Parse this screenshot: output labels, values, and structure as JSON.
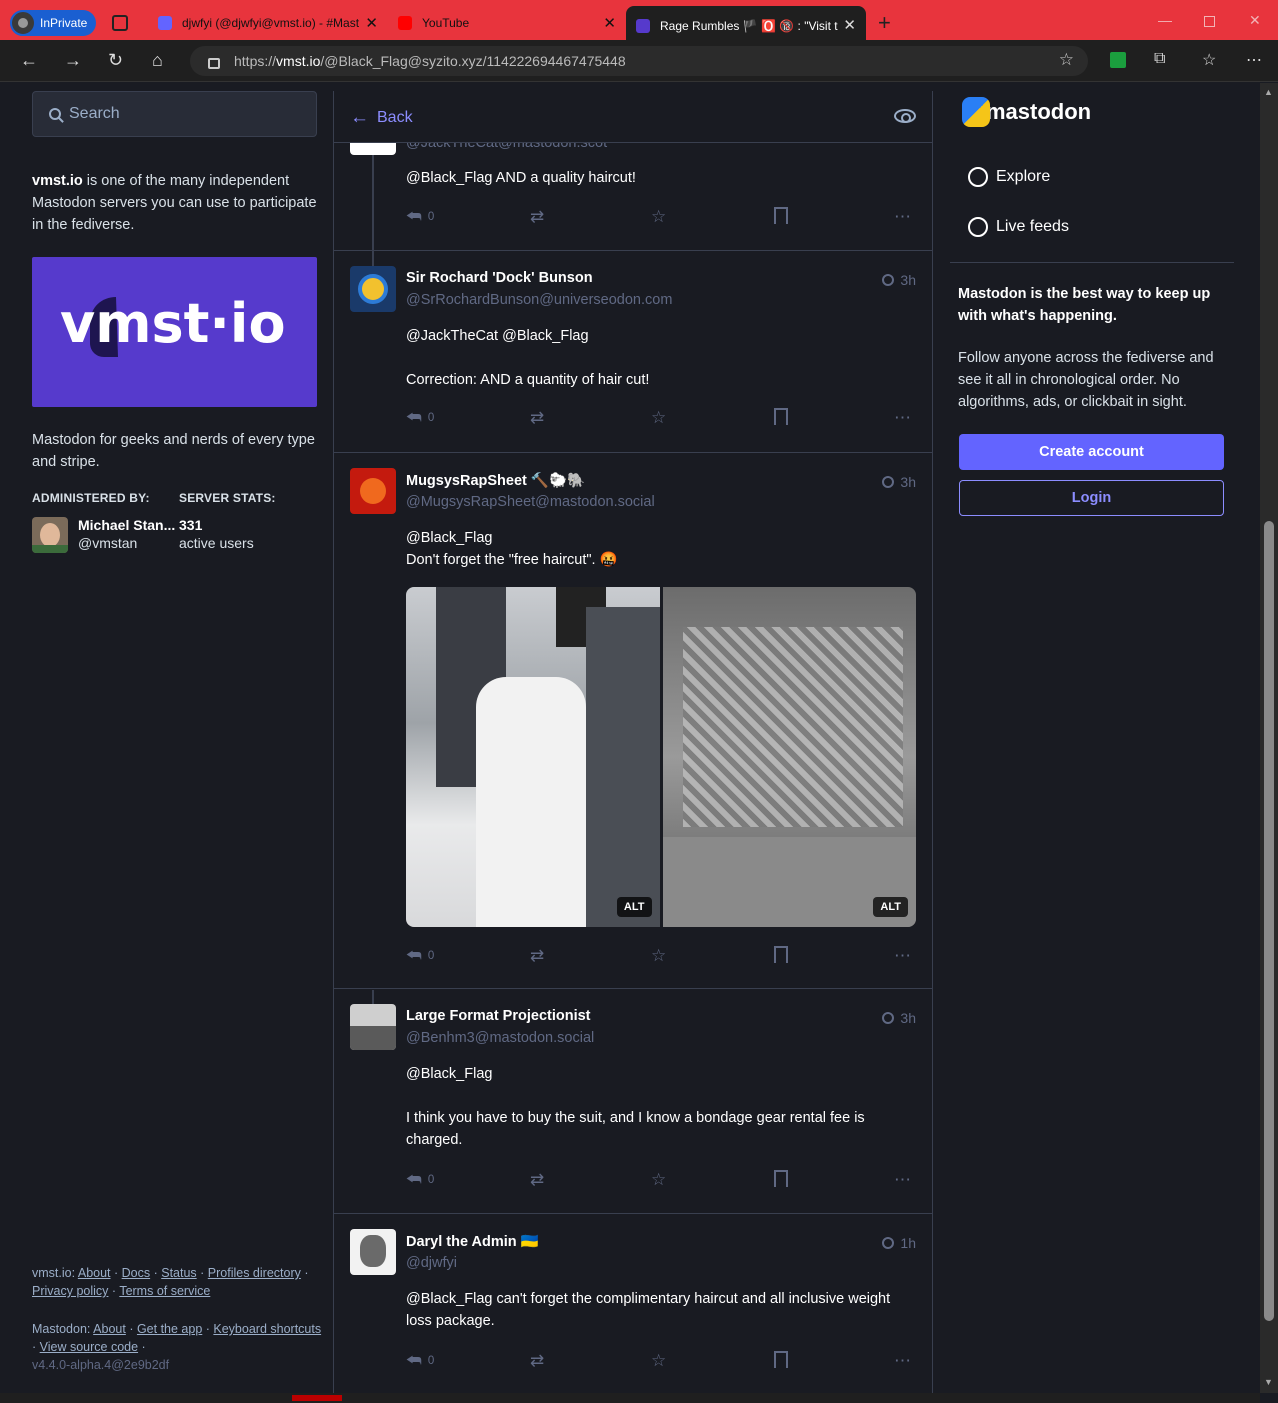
{
  "browser": {
    "inprivate_label": "InPrivate",
    "tabs": [
      {
        "title": "djwfyi (@djwfyi@vmst.io) - #Mast",
        "favicon_color": "#6364ff"
      },
      {
        "title": "YouTube",
        "favicon_color": "#ff0000"
      },
      {
        "title": "Rage Rumbles 🏴 🅾️ 🔞 : \"Visit the",
        "favicon_color": "#563acc"
      }
    ],
    "url_prefix": "https://",
    "url_domain": "vmst.io",
    "url_path": "/@Black_Flag@syzito.xyz/114222694467475448"
  },
  "left": {
    "search_placeholder": "Search",
    "intro_server": "vmst.io",
    "intro_text": " is one of the many independent Mastodon servers you can use to participate in the fediverse.",
    "banner_text": "vmst·io",
    "tagline": "Mastodon for geeks and nerds of every type and stripe.",
    "administered_by_label": "ADMINISTERED BY:",
    "server_stats_label": "SERVER STATS:",
    "admin_name": "Michael Stan...",
    "admin_handle": "@vmstan",
    "active_users_count": "331",
    "active_users_label": "active users",
    "footer": {
      "server_label": "vmst.io:",
      "server_links": [
        "About",
        "Docs",
        "Status",
        "Profiles directory",
        "Privacy policy",
        "Terms of service"
      ],
      "mastodon_label": "Mastodon:",
      "mastodon_links": [
        "About",
        "Get the app",
        "Keyboard shortcuts",
        "View source code"
      ],
      "version": "v4.4.0-alpha.4@2e9b2df"
    }
  },
  "center": {
    "back_label": "Back",
    "partial_post": {
      "handle": "@JackTheCat@mastodon.scot",
      "text": "@Black_Flag AND a quality haircut!",
      "replies": "0"
    },
    "posts": [
      {
        "name": "Sir Rochard 'Dock' Bunson",
        "handle": "@SrRochardBunson@universeodon.com",
        "time": "3h",
        "lines": [
          "@JackTheCat @Black_Flag",
          "",
          "Correction: AND a quantity of hair cut!"
        ],
        "replies": "0"
      },
      {
        "name": "MugsysRapSheet 🔨🐑🐘",
        "handle": "@MugsysRapSheet@mastodon.social",
        "time": "3h",
        "lines": [
          "@Black_Flag",
          "Don't forget the \"free haircut\". 🤬"
        ],
        "media_alt_labels": [
          "ALT",
          "ALT"
        ],
        "replies": "0"
      },
      {
        "name": "Large Format Projectionist",
        "handle": "@Benhm3@mastodon.social",
        "time": "3h",
        "lines": [
          "@Black_Flag",
          "",
          "I think you have to buy the suit, and I know a bondage gear rental fee is charged."
        ],
        "replies": "0"
      },
      {
        "name": "Daryl the Admin 🇺🇦",
        "handle": "@djwfyi",
        "time": "1h",
        "lines": [
          "@Black_Flag can't forget the complimentary haircut and all inclusive weight loss package."
        ],
        "replies": "0"
      }
    ]
  },
  "right": {
    "logo_text": "mastodon",
    "nav": [
      "Explore",
      "Live feeds"
    ],
    "headline": "Mastodon is the best way to keep up with what's happening.",
    "body": "Follow anyone across the fediverse and see it all in chronological order. No algorithms, ads, or clickbait in sight.",
    "create_account": "Create account",
    "login": "Login"
  },
  "colors": {
    "accent": "#6364ff",
    "link": "#8c8dff",
    "background": "#191b22",
    "muted": "#606984",
    "browser_frame": "#e8343d"
  }
}
